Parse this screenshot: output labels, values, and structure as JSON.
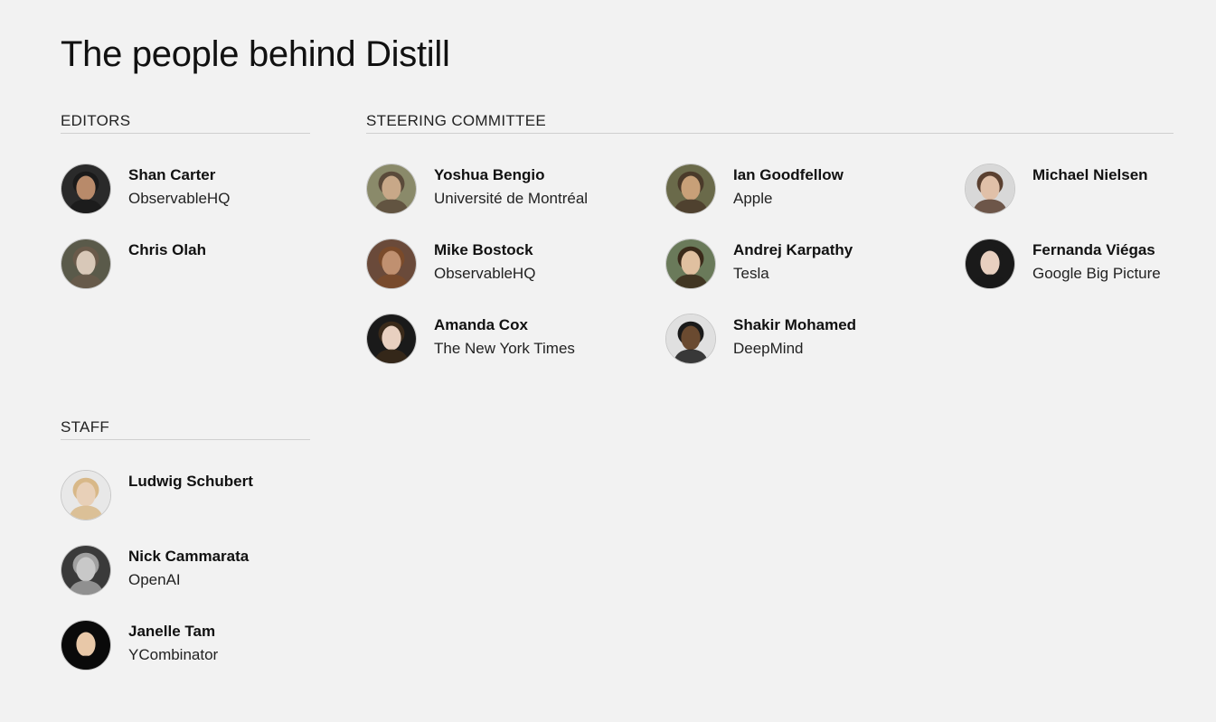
{
  "page": {
    "title": "The people behind Distill"
  },
  "editors": {
    "heading": "EDITORS",
    "people": [
      {
        "name": "Shan Carter",
        "affiliation": "ObservableHQ",
        "bg": "#2a2a2a",
        "skin": "#b88a6a",
        "hair": "#1a1a1a",
        "icon": "portrait-photo"
      },
      {
        "name": "Chris Olah",
        "affiliation": "",
        "bg": "#5a5a4a",
        "skin": "#d8c8b8",
        "hair": "#6a5a4a",
        "icon": "portrait-photo"
      }
    ]
  },
  "steering": {
    "heading": "STEERING COMMITTEE",
    "people": [
      {
        "name": "Yoshua Bengio",
        "affiliation": "Université de Montréal",
        "bg": "#8a8a6a",
        "skin": "#c8a888",
        "hair": "#5a4a3a",
        "icon": "portrait-photo"
      },
      {
        "name": "Ian Goodfellow",
        "affiliation": "Apple",
        "bg": "#6a6a4a",
        "skin": "#c8a078",
        "hair": "#4a3a2a",
        "icon": "portrait-photo"
      },
      {
        "name": "Michael Nielsen",
        "affiliation": "",
        "bg": "#d8d8d8",
        "skin": "#e0c0a8",
        "hair": "#5a4030",
        "icon": "portrait-photo"
      },
      {
        "name": "Mike Bostock",
        "affiliation": "ObservableHQ",
        "bg": "#6a4a3a",
        "skin": "#c09070",
        "hair": "#7a4a2a",
        "icon": "portrait-photo"
      },
      {
        "name": "Andrej Karpathy",
        "affiliation": "Tesla",
        "bg": "#6a7a5a",
        "skin": "#e0c0a0",
        "hair": "#3a2a1a",
        "icon": "portrait-photo"
      },
      {
        "name": "Fernanda Viégas",
        "affiliation": "Google Big Picture",
        "bg": "#1a1a1a",
        "skin": "#e8d0c0",
        "hair": "#1a1a1a",
        "icon": "portrait-photo"
      },
      {
        "name": "Amanda Cox",
        "affiliation": "The New York Times",
        "bg": "#1a1a1a",
        "skin": "#e8d0c0",
        "hair": "#3a2a1a",
        "icon": "portrait-photo"
      },
      {
        "name": "Shakir Mohamed",
        "affiliation": "DeepMind",
        "bg": "#e0e0e0",
        "skin": "#6a4a30",
        "hair": "#1a1a1a",
        "icon": "portrait-photo"
      }
    ]
  },
  "staff": {
    "heading": "STAFF",
    "people": [
      {
        "name": "Ludwig Schubert",
        "affiliation": "",
        "bg": "#e8e8e8",
        "skin": "#e8d0b8",
        "hair": "#d8b888",
        "icon": "portrait-photo"
      },
      {
        "name": "Nick Cammarata",
        "affiliation": "OpenAI",
        "bg": "#3a3a3a",
        "skin": "#c8c8c8",
        "hair": "#a0a0a0",
        "icon": "portrait-photo"
      },
      {
        "name": "Janelle Tam",
        "affiliation": "YCombinator",
        "bg": "#0a0a0a",
        "skin": "#e8c8a8",
        "hair": "#0a0a0a",
        "icon": "portrait-photo"
      }
    ]
  }
}
